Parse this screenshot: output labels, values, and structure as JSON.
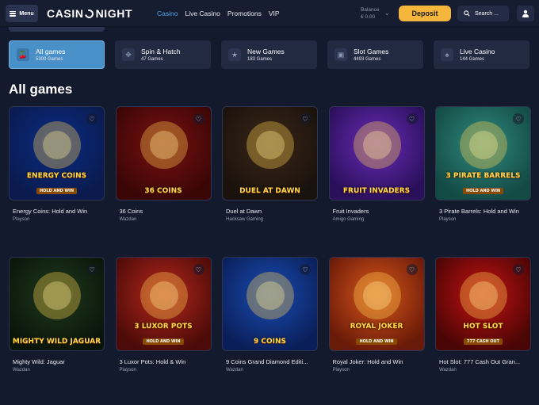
{
  "header": {
    "menu_label": "Menu",
    "logo_left": "CASIN",
    "logo_right": "NIGHT",
    "nav": [
      "Casino",
      "Live Casino",
      "Promotions",
      "VIP"
    ],
    "balance_label": "Balance",
    "balance_value": "€ 0.00",
    "deposit_label": "Deposit",
    "search_label": "Search ...",
    "accent": "#4aa3df",
    "deposit_color": "#f5b73b"
  },
  "categories": [
    {
      "name": "All games",
      "count": "5309 Games",
      "icon": "cherry-icon",
      "active": true
    },
    {
      "name": "Spin & Hatch",
      "count": "47 Games",
      "icon": "puzzle-icon",
      "active": false
    },
    {
      "name": "New Games",
      "count": "183 Games",
      "icon": "star-icon",
      "active": false
    },
    {
      "name": "Slot Games",
      "count": "4493 Games",
      "icon": "slot-machine-icon",
      "active": false
    },
    {
      "name": "Live Casino",
      "count": "144 Games",
      "icon": "cards-icon",
      "active": false
    }
  ],
  "section_title": "All games",
  "games": [
    {
      "title": "Energy Coins: Hold and Win",
      "provider": "Playson",
      "art_text": "ENERGY COINS",
      "art_sub": "HOLD AND WIN",
      "bg1": "#0b2d86",
      "bg2": "#0a1a4d"
    },
    {
      "title": "36 Coins",
      "provider": "Wazdan",
      "art_text": "36 COINS",
      "art_sub": "",
      "bg1": "#7a1010",
      "bg2": "#3a0606"
    },
    {
      "title": "Duel at Dawn",
      "provider": "Hacksaw Gaming",
      "art_text": "DUEL AT DAWN",
      "art_sub": "",
      "bg1": "#3b2618",
      "bg2": "#1a120c"
    },
    {
      "title": "Fruit Invaders",
      "provider": "Amigo Gaming",
      "art_text": "FRUIT INVADERS",
      "art_sub": "",
      "bg1": "#6a2cb8",
      "bg2": "#2a0f5a"
    },
    {
      "title": "3 Pirate Barrels: Hold and Win",
      "provider": "Playson",
      "art_text": "3 PIRATE BARRELS",
      "art_sub": "HOLD AND WIN",
      "bg1": "#2f8a7f",
      "bg2": "#134a44"
    },
    {
      "title": "Mighty Wild: Jaguar",
      "provider": "Wazdan",
      "art_text": "MIGHTY WILD JAGUAR",
      "art_sub": "",
      "bg1": "#1e3a1c",
      "bg2": "#0a150a"
    },
    {
      "title": "3 Luxor Pots: Hold & Win",
      "provider": "Playson",
      "art_text": "3 LUXOR POTS",
      "art_sub": "HOLD AND WIN",
      "bg1": "#b8271c",
      "bg2": "#4c0b08"
    },
    {
      "title": "9 Coins Grand Diamond Editi...",
      "provider": "Wazdan",
      "art_text": "9 COINS",
      "art_sub": "",
      "bg1": "#1a4db3",
      "bg2": "#0a1f5a"
    },
    {
      "title": "Royal Joker: Hold and Win",
      "provider": "Playson",
      "art_text": "ROYAL JOKER",
      "art_sub": "HOLD AND WIN",
      "bg1": "#d8561b",
      "bg2": "#6a1a08"
    },
    {
      "title": "Hot Slot: 777 Cash Out Gran...",
      "provider": "Wazdan",
      "art_text": "HOT SLOT",
      "art_sub": "777 CASH OUT",
      "bg1": "#c71212",
      "bg2": "#4a0505"
    }
  ]
}
